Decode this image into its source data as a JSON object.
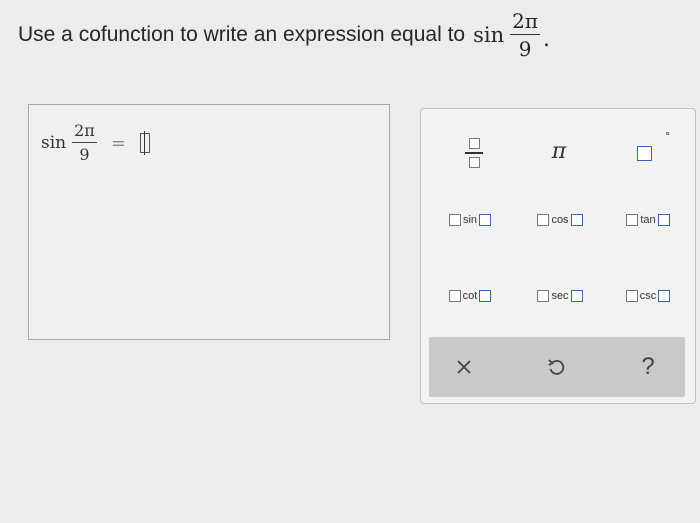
{
  "question": {
    "prefix": "Use a cofunction to write an expression equal to",
    "func": "sin",
    "numerator": "2π",
    "denominator": "9",
    "suffix": "."
  },
  "answer": {
    "func": "sin",
    "numerator": "2π",
    "denominator": "9",
    "equals": "="
  },
  "palette": {
    "pi": "π",
    "degree": "°",
    "trig": [
      "sin",
      "cos",
      "tan",
      "cot",
      "sec",
      "csc"
    ],
    "toolbar": {
      "clear_icon": "close-icon",
      "undo_icon": "undo-icon",
      "help_label": "?"
    }
  },
  "colors": {
    "template_box": "#2f66b8",
    "toolbar_bg": "#c9c9c9"
  }
}
